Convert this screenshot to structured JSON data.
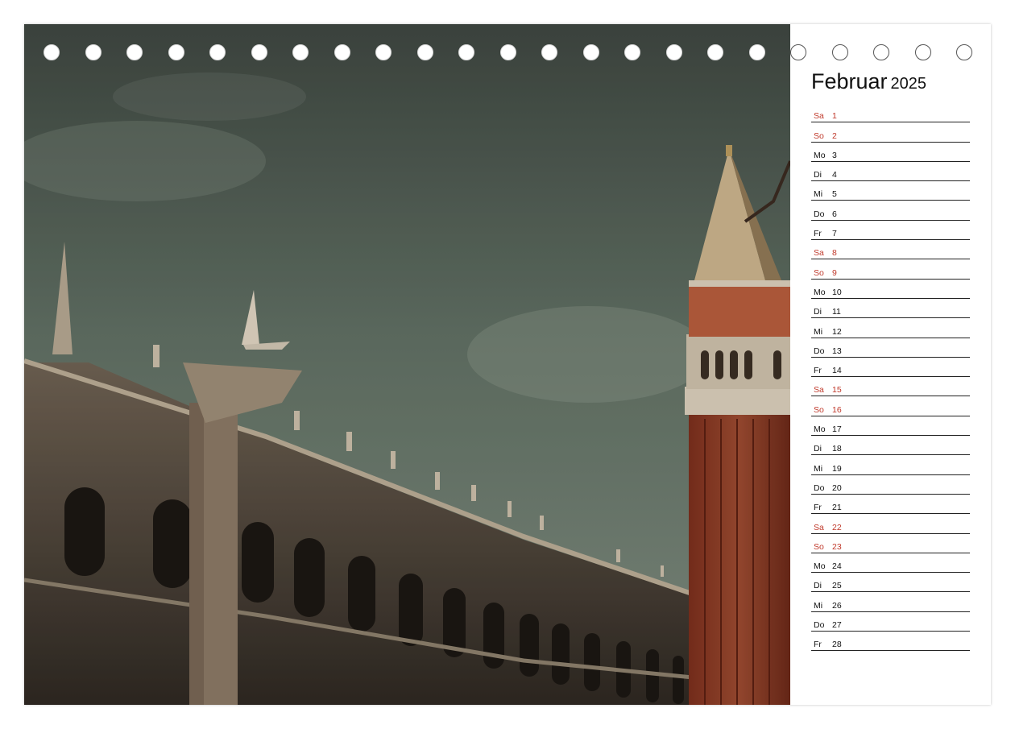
{
  "calendar": {
    "month": "Februar",
    "year": "2025",
    "days": [
      {
        "weekday": "Sa",
        "day": "1",
        "weekend": true
      },
      {
        "weekday": "So",
        "day": "2",
        "weekend": true
      },
      {
        "weekday": "Mo",
        "day": "3",
        "weekend": false
      },
      {
        "weekday": "Di",
        "day": "4",
        "weekend": false
      },
      {
        "weekday": "Mi",
        "day": "5",
        "weekend": false
      },
      {
        "weekday": "Do",
        "day": "6",
        "weekend": false
      },
      {
        "weekday": "Fr",
        "day": "7",
        "weekend": false
      },
      {
        "weekday": "Sa",
        "day": "8",
        "weekend": true
      },
      {
        "weekday": "So",
        "day": "9",
        "weekend": true
      },
      {
        "weekday": "Mo",
        "day": "10",
        "weekend": false
      },
      {
        "weekday": "Di",
        "day": "11",
        "weekend": false
      },
      {
        "weekday": "Mi",
        "day": "12",
        "weekend": false
      },
      {
        "weekday": "Do",
        "day": "13",
        "weekend": false
      },
      {
        "weekday": "Fr",
        "day": "14",
        "weekend": false
      },
      {
        "weekday": "Sa",
        "day": "15",
        "weekend": true
      },
      {
        "weekday": "So",
        "day": "16",
        "weekend": true
      },
      {
        "weekday": "Mo",
        "day": "17",
        "weekend": false
      },
      {
        "weekday": "Di",
        "day": "18",
        "weekend": false
      },
      {
        "weekday": "Mi",
        "day": "19",
        "weekend": false
      },
      {
        "weekday": "Do",
        "day": "20",
        "weekend": false
      },
      {
        "weekday": "Fr",
        "day": "21",
        "weekend": false
      },
      {
        "weekday": "Sa",
        "day": "22",
        "weekend": true
      },
      {
        "weekday": "So",
        "day": "23",
        "weekend": true
      },
      {
        "weekday": "Mo",
        "day": "24",
        "weekend": false
      },
      {
        "weekday": "Di",
        "day": "25",
        "weekend": false
      },
      {
        "weekday": "Mi",
        "day": "26",
        "weekend": false
      },
      {
        "weekday": "Do",
        "day": "27",
        "weekend": false
      },
      {
        "weekday": "Fr",
        "day": "28",
        "weekend": false
      }
    ]
  },
  "colors": {
    "weekend_text": "#c0392b",
    "weekday_text": "#111111",
    "sky": "#5d6a5e",
    "tower_brick": "#8a3a26"
  },
  "photo": {
    "subject_icon": "venice-piazza-san-marco-photo"
  },
  "binding": {
    "hole_count": 23,
    "icon": "spiral-binding-hole-icon"
  }
}
